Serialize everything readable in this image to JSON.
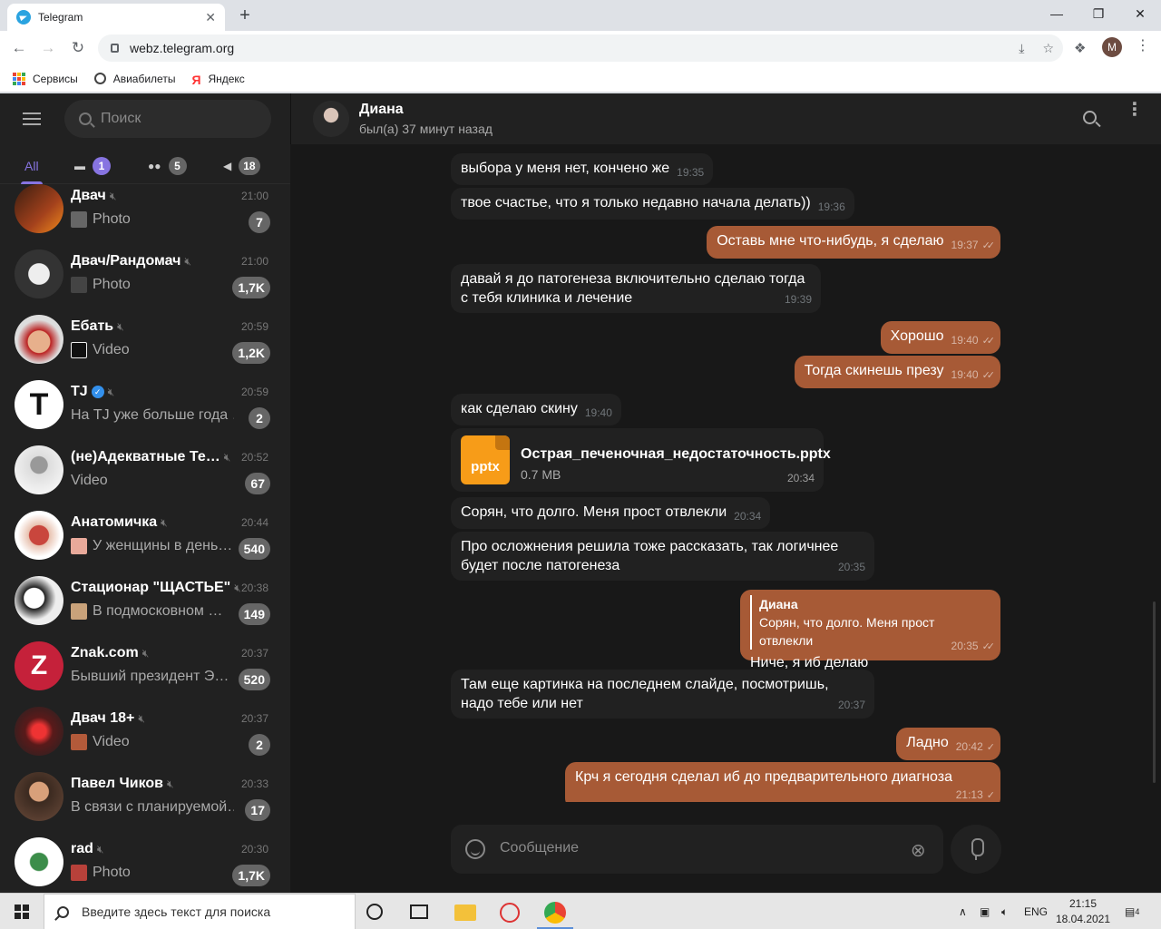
{
  "browser": {
    "tab_title": "Telegram",
    "tab_close": "✕",
    "new_tab": "+",
    "url": "webz.telegram.org",
    "bookmarks": [
      {
        "label": "Сервисы"
      },
      {
        "label": "Авиабилеты"
      },
      {
        "label": "Яндекс"
      }
    ],
    "profile_letter": "M"
  },
  "sidebar": {
    "search_placeholder": "Поиск",
    "folders": [
      {
        "label": "All",
        "badge": ""
      },
      {
        "label": "",
        "badge": "1"
      },
      {
        "label": "",
        "badge": "5"
      },
      {
        "label": "",
        "badge": "18"
      }
    ],
    "chats": [
      {
        "name": "Двач",
        "time": "21:00",
        "preview": "Photo",
        "badge": "7"
      },
      {
        "name": "Двач/Рандомач",
        "time": "21:00",
        "preview": "Photo",
        "badge": "1,7K"
      },
      {
        "name": "Ебать",
        "time": "20:59",
        "preview": "Video",
        "badge": "1,2K"
      },
      {
        "name": "TJ",
        "time": "20:59",
        "preview": "На TJ уже больше года …",
        "badge": "2"
      },
      {
        "name": "(не)Адекватные Те…",
        "time": "20:52",
        "preview": "Video",
        "badge": "67"
      },
      {
        "name": "Анатомичка",
        "time": "20:44",
        "preview": "У женщины в день…",
        "badge": "540"
      },
      {
        "name": "Стационар \"ЩАСТЬЕ\"",
        "time": "20:38",
        "preview": "В подмосковном …",
        "badge": "149"
      },
      {
        "name": "Znak.com",
        "time": "20:37",
        "preview": "Бывший президент Э…",
        "badge": "520"
      },
      {
        "name": "Двач 18+",
        "time": "20:37",
        "preview": "Video",
        "badge": "2"
      },
      {
        "name": "Павел Чиков",
        "time": "20:33",
        "preview": "В связи с планируемой…",
        "badge": "17"
      },
      {
        "name": "rad",
        "time": "20:30",
        "preview": "Photo",
        "badge": "1,7K"
      }
    ]
  },
  "chat": {
    "name": "Диана",
    "status": "был(а) 37 минут назад",
    "messages": [
      {
        "dir": "in",
        "text": "выбора у меня нет, кончено же",
        "time": "19:35"
      },
      {
        "dir": "in",
        "text": "твое счастье, что я только недавно начала делать))",
        "time": "19:36"
      },
      {
        "dir": "out",
        "text": "Оставь мне что-нибудь, я сделаю",
        "time": "19:37"
      },
      {
        "dir": "in",
        "text_lines": [
          "давай я до патогенеза включительно сделаю тогда",
          "с тебя клиника и лечение"
        ],
        "time": "19:39"
      },
      {
        "dir": "out",
        "text": "Хорошо",
        "time": "19:40"
      },
      {
        "dir": "out",
        "text": "Тогда скинешь презу",
        "time": "19:40"
      },
      {
        "dir": "in",
        "text": "как сделаю скину",
        "time": "19:40"
      },
      {
        "dir": "in",
        "file_name": "Острая_печеночная_недостаточность.pptx",
        "file_size": "0.7 MB",
        "file_ext": "pptx",
        "time": "20:34"
      },
      {
        "dir": "in",
        "text": "Сорян, что долго. Меня прост отвлекли",
        "time": "20:34"
      },
      {
        "dir": "in",
        "text_lines": [
          "Про осложнения решила тоже рассказать, так логичнее",
          "будет после патогенеза"
        ],
        "time": "20:35"
      },
      {
        "dir": "out",
        "reply_name": "Диана",
        "reply_text": "Сорян, что долго. Меня прост отвлекли",
        "text": "Ниче, я иб делаю",
        "time": "20:35"
      },
      {
        "dir": "in",
        "text_lines": [
          "Там еще картинка на последнем слайде, посмотришь,",
          "надо тебе или нет"
        ],
        "time": "20:37"
      },
      {
        "dir": "out",
        "text": "Ладно",
        "time": "20:42"
      },
      {
        "dir": "out",
        "text": "Крч я сегодня сделал иб до предварительного диагноза",
        "time": "21:13"
      }
    ],
    "composer_placeholder": "Сообщение"
  },
  "taskbar": {
    "search_placeholder": "Введите здесь текст для поиска",
    "lang": "ENG",
    "time": "21:15",
    "date": "18.04.2021",
    "notification_count": "4"
  },
  "colors": {
    "accent": "#8774e1",
    "outgoing_bubble": "#a75a36",
    "incoming_bubble": "#212121",
    "sidebar_bg": "#212121",
    "chat_bg": "#181818"
  }
}
